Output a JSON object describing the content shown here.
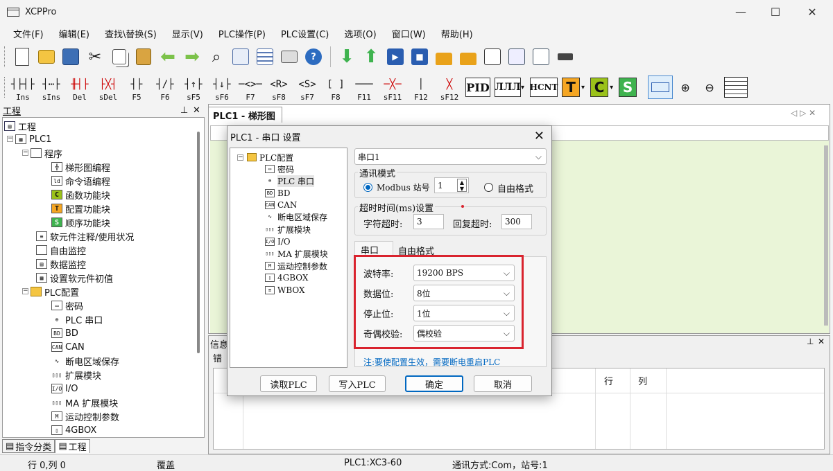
{
  "window": {
    "title": "XCPPro",
    "min_glyph": "—",
    "max_glyph": "☐",
    "close_glyph": "✕"
  },
  "menu": [
    "文件(F)",
    "编辑(E)",
    "查找\\替换(S)",
    "显示(V)",
    "PLC操作(P)",
    "PLC设置(C)",
    "选项(O)",
    "窗口(W)",
    "帮助(H)"
  ],
  "toolbar1_icons": [
    "new-file-icon",
    "open-folder-icon",
    "save-icon",
    "cut-icon",
    "copy-icon",
    "paste-icon",
    "back-arrow-icon",
    "forward-arrow-icon",
    "find-icon",
    "ladder-icon",
    "list-icon",
    "print-icon",
    "help-icon",
    "download-icon",
    "upload-icon",
    "run-icon",
    "stop-icon",
    "lock-icon",
    "unlock-icon",
    "monitor-icon",
    "zoom-preview-icon",
    "preview-icon",
    "serial-port-icon"
  ],
  "ladder_tools": [
    {
      "sym": "┤├┤├",
      "label": "Ins"
    },
    {
      "sym": "┤⋯├",
      "label": "sIns"
    },
    {
      "sym": "╫┤├",
      "label": "Del"
    },
    {
      "sym": "├╳┤",
      "label": "sDel"
    },
    {
      "sym": "┤├",
      "label": "F5"
    },
    {
      "sym": "┤/├",
      "label": "F6"
    },
    {
      "sym": "┤↑├",
      "label": "sF5"
    },
    {
      "sym": "┤↓├",
      "label": "sF6"
    },
    {
      "sym": "─<>─",
      "label": "F7"
    },
    {
      "sym": "<R>",
      "label": "sF8"
    },
    {
      "sym": "<S>",
      "label": "sF7"
    },
    {
      "sym": "[ ]",
      "label": "F8"
    },
    {
      "sym": "───",
      "label": "F11"
    },
    {
      "sym": "─╳─",
      "label": "sF11"
    },
    {
      "sym": "│",
      "label": "F12"
    },
    {
      "sym": "╳",
      "label": "sF12"
    }
  ],
  "special_buttons": {
    "pid": "PID",
    "pulse": "ЛЛЛ",
    "hcnt": "HCNT",
    "t": "T",
    "c": "C",
    "s": "S"
  },
  "colors": {
    "t_bg": "#f5a623",
    "c_bg": "#9bc21a",
    "s_bg": "#3fb34f",
    "accent": "#0067c0",
    "red": "#d9232e",
    "green_area": "#eaf5d8"
  },
  "project_panel": {
    "title": "工程",
    "items": [
      {
        "label": "工程",
        "icon": "project-icon"
      },
      {
        "label": "PLC1",
        "icon": "plc-icon"
      },
      {
        "label": "程序",
        "icon": "program-icon"
      },
      {
        "label": "梯形图编程",
        "icon": "ladder-program-icon"
      },
      {
        "label": "命令语编程",
        "icon": "instruction-program-icon"
      },
      {
        "label": "函数功能块",
        "icon": "function-block-c-icon"
      },
      {
        "label": "配置功能块",
        "icon": "function-block-t-icon"
      },
      {
        "label": "顺序功能块",
        "icon": "function-block-s-icon"
      },
      {
        "label": "软元件注释/使用状况",
        "icon": "comment-icon"
      },
      {
        "label": "自由监控",
        "icon": "free-monitor-icon"
      },
      {
        "label": "数据监控",
        "icon": "data-monitor-icon"
      },
      {
        "label": "设置软元件初值",
        "icon": "init-value-icon"
      },
      {
        "label": "PLC配置",
        "icon": "folder-icon"
      },
      {
        "label": "密码",
        "icon": "password-icon"
      },
      {
        "label": "PLC 串口",
        "icon": "serial-icon"
      },
      {
        "label": "BD",
        "icon": "bd-icon"
      },
      {
        "label": "CAN",
        "icon": "can-icon"
      },
      {
        "label": "断电区域保存",
        "icon": "power-off-save-icon"
      },
      {
        "label": "扩展模块",
        "icon": "expansion-icon"
      },
      {
        "label": "I/O",
        "icon": "io-icon"
      },
      {
        "label": "MA 扩展模块",
        "icon": "ma-expansion-icon"
      },
      {
        "label": "运动控制参数",
        "icon": "motion-control-icon"
      },
      {
        "label": "4GBOX",
        "icon": "4gbox-icon"
      }
    ],
    "bottom_tabs": [
      "指令分类",
      "工程"
    ]
  },
  "doc_tab": "PLC1 - 梯形图",
  "info_panel": {
    "title": "信息",
    "row_label": "错",
    "col_row": "行",
    "col_col": "列"
  },
  "status": {
    "pos": "行 0,列 0",
    "mode": "覆盖",
    "plc": "PLC1:XC3-60",
    "comm": "通讯方式:Com，站号:1"
  },
  "dialog": {
    "title": "PLC1 - 串口 设置",
    "tree": [
      {
        "label": "PLC配置",
        "icon": "folder-icon"
      },
      {
        "label": "密码",
        "icon": "password-icon"
      },
      {
        "label": "PLC 串口",
        "icon": "serial-icon"
      },
      {
        "label": "BD",
        "icon": "bd-icon"
      },
      {
        "label": "CAN",
        "icon": "can-icon"
      },
      {
        "label": "断电区域保存",
        "icon": "power-off-save-icon"
      },
      {
        "label": "扩展模块",
        "icon": "expansion-icon"
      },
      {
        "label": "I/O",
        "icon": "io-icon"
      },
      {
        "label": "MA 扩展模块",
        "icon": "ma-expansion-icon"
      },
      {
        "label": "运动控制参数",
        "icon": "motion-control-icon"
      },
      {
        "label": "4GBOX",
        "icon": "4gbox-icon"
      },
      {
        "label": "WBOX",
        "icon": "wbox-icon"
      }
    ],
    "port_select": "串口1",
    "comm_mode_label": "通讯模式",
    "modbus_label": "Modbus 站号",
    "station": "1",
    "free_format_label": "自由格式",
    "timeout_label": "超时时间(ms)设置",
    "char_timeout_label": "字符超时:",
    "char_timeout": "3",
    "reply_timeout_label": "回复超时:",
    "reply_timeout": "300",
    "tabs": [
      "串口",
      "自由格式"
    ],
    "baud_label": "波特率:",
    "baud": "19200 BPS",
    "data_bits_label": "数据位:",
    "data_bits": "8位",
    "stop_bits_label": "停止位:",
    "stop_bits": "1位",
    "parity_label": "奇偶校验:",
    "parity": "偶校验",
    "note": "注:要使配置生效，需要断电重启PLC",
    "buttons": {
      "read": "读取PLC",
      "write": "写入PLC",
      "ok": "确定",
      "cancel": "取消"
    }
  }
}
